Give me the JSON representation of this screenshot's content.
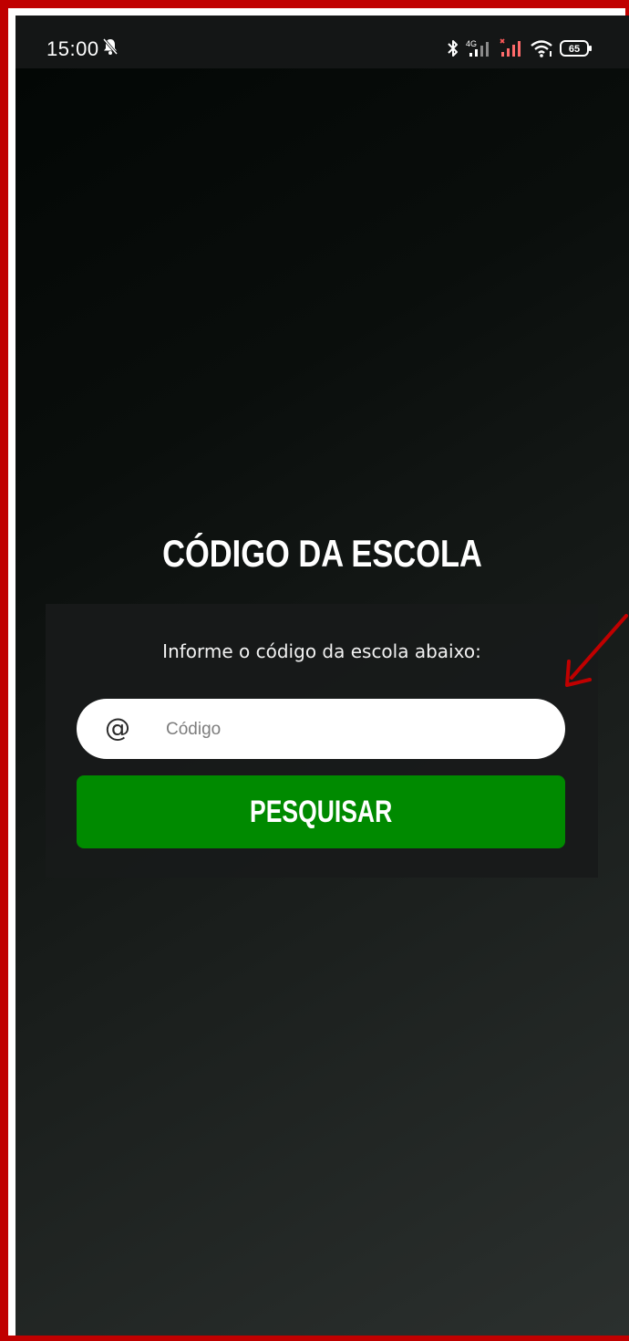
{
  "status_bar": {
    "time": "15:00",
    "network_label": "4G",
    "battery_level": "65",
    "icons": [
      "mute-icon",
      "bluetooth-icon",
      "signal-4g-icon",
      "signal-no-service-icon",
      "wifi-icon",
      "battery-icon"
    ]
  },
  "page": {
    "title": "CÓDIGO DA ESCOLA",
    "instruction": "Informe o código da escola abaixo:"
  },
  "form": {
    "input_icon": "@",
    "input_placeholder": "Código",
    "input_value": "",
    "button_label": "PESQUISAR"
  },
  "colors": {
    "button": "#008a00",
    "frame_border": "#c00000",
    "annotation_arrow": "#c00000"
  }
}
